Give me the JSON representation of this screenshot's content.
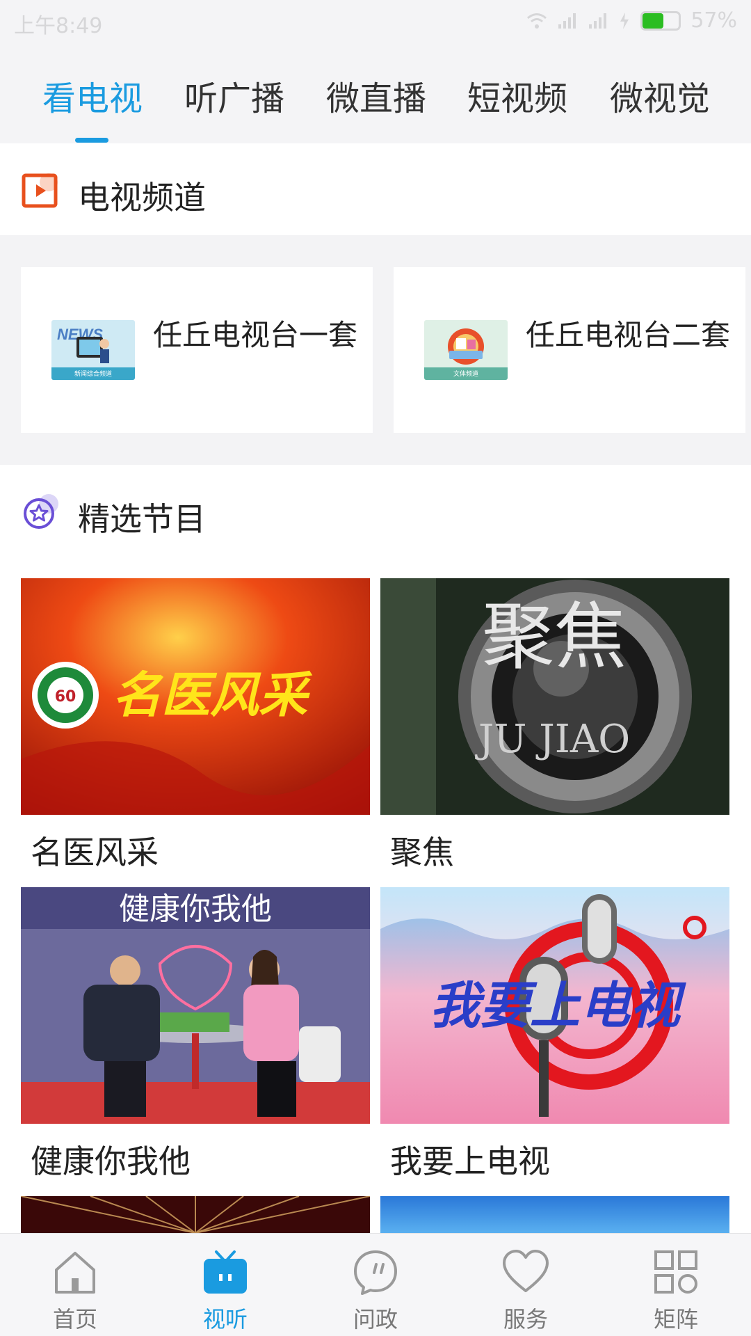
{
  "status_bar": {
    "time": "上午8:49",
    "battery_text": "57%",
    "battery_level": 0.57,
    "battery_color": "#2bbd22"
  },
  "top_tabs": [
    {
      "label": "看电视",
      "active": true
    },
    {
      "label": "听广播",
      "active": false
    },
    {
      "label": "微直播",
      "active": false
    },
    {
      "label": "短视频",
      "active": false
    },
    {
      "label": "微视觉",
      "active": false
    }
  ],
  "accent_color": "#1a9be0",
  "tv_channels": {
    "title": "电视频道",
    "icon": "play-icon",
    "items": [
      {
        "name": "任丘电视台一套",
        "thumb_text": "新闻综合频道",
        "thumb_icon": "news-channel-icon"
      },
      {
        "name": "任丘电视台二套",
        "thumb_text": "文体频道",
        "thumb_icon": "culture-channel-icon"
      }
    ]
  },
  "featured": {
    "title": "精选节目",
    "icon": "star-icon",
    "programs": [
      {
        "label": "名医风采",
        "thumb_text": "名医风采"
      },
      {
        "label": "聚焦",
        "thumb_text": "聚焦",
        "thumb_subtext": "JU JIAO"
      },
      {
        "label": "健康你我他",
        "thumb_text": "健康你我他"
      },
      {
        "label": "我要上电视",
        "thumb_text": "我要上电视"
      }
    ]
  },
  "bottom_nav": [
    {
      "label": "首页",
      "icon": "home-icon",
      "active": false
    },
    {
      "label": "视听",
      "icon": "tv-icon",
      "active": true
    },
    {
      "label": "问政",
      "icon": "chat-icon",
      "active": false
    },
    {
      "label": "服务",
      "icon": "heart-icon",
      "active": false
    },
    {
      "label": "矩阵",
      "icon": "grid-icon",
      "active": false
    }
  ]
}
